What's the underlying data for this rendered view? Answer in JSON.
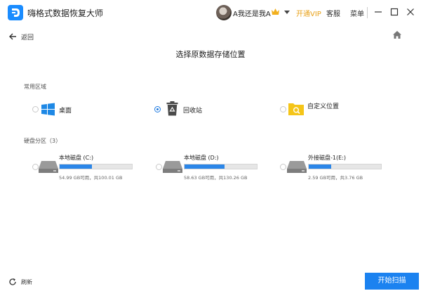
{
  "window": {
    "title": "嗨格式数据恢复大师",
    "user_name": "A我还是我A",
    "vip_label": "开通VIP",
    "service_label": "客服",
    "menu_label": "菜单"
  },
  "nav": {
    "back_label": "返回"
  },
  "page": {
    "title": "选择原数据存储位置"
  },
  "common": {
    "section_label": "常用区域",
    "items": [
      {
        "label": "桌面",
        "icon": "windows-icon",
        "selected": false
      },
      {
        "label": "回收站",
        "icon": "recycle-bin-icon",
        "selected": true
      },
      {
        "label": "自定义位置",
        "icon": "folder-search-icon",
        "selected": false
      }
    ]
  },
  "disks": {
    "section_label": "硬盘分区（3）",
    "items": [
      {
        "name": "本地磁盘 (C:)",
        "info": "54.99 GB可用，共100.01 GB",
        "used_fraction": 0.45
      },
      {
        "name": "本地磁盘 (D:)",
        "info": "58.63 GB可用，共130.26 GB",
        "used_fraction": 0.55
      },
      {
        "name": "外接磁盘-1(E:)",
        "info": "2.59 GB可用，共3.76 GB",
        "used_fraction": 0.31
      }
    ]
  },
  "footer": {
    "refresh_label": "刷新",
    "scan_label": "开始扫描"
  },
  "colors": {
    "accent": "#1b82f0",
    "vip": "#e8a21a",
    "folder": "#f5c518"
  }
}
